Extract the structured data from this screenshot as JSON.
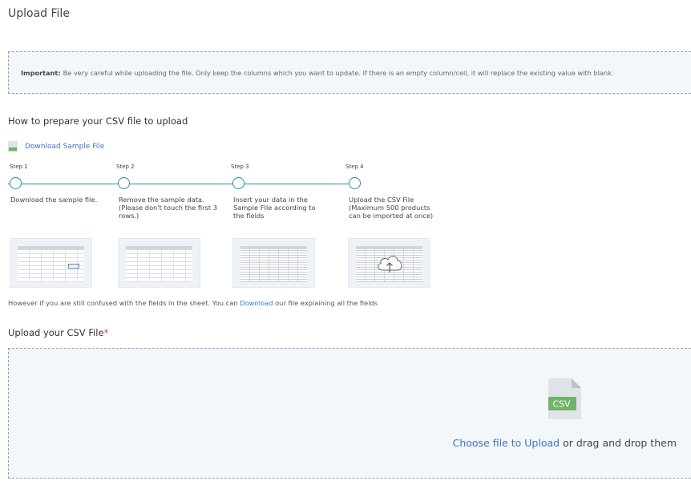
{
  "page": {
    "title": "Upload File"
  },
  "notice": {
    "label": "Important:",
    "text": "Be very careful while uploading the file. Only keep the columns which you want to update. If there is an empty column/cell, it will replace the existing value with blank."
  },
  "prepare": {
    "title": "How to prepare your CSV file to upload",
    "download_sample": "Download Sample File",
    "steps": [
      {
        "label": "Step 1",
        "desc": "Download the sample file."
      },
      {
        "label": "Step 2",
        "desc": "Remove the sample data. (Please don't touch the first 3 rows.)"
      },
      {
        "label": "Step 3",
        "desc": "Insert your data in the Sample FIle according to the fields"
      },
      {
        "label": "Step 4",
        "desc": "Upload the CSV File (Maximum 500 products can be imported at once)"
      }
    ],
    "help_prefix": "However if you are still confused with the fields in the sheet. You can",
    "help_link": "Download",
    "help_suffix": "our file explaining all the fields"
  },
  "upload": {
    "title": "Upload your CSV File",
    "required_mark": "*",
    "file_badge": "CSV",
    "choose_link": "Choose file to Upload",
    "choose_suffix": "or drag and drop them"
  },
  "colors": {
    "accent": "#2a8ca0",
    "link": "#3c74c4",
    "required": "#d63b3b",
    "csv_badge": "#6fb46c"
  },
  "icons": {
    "sample_file": "csv-file-icon",
    "step4_thumb": "cloud-upload-icon",
    "dropzone": "csv-file-icon"
  }
}
